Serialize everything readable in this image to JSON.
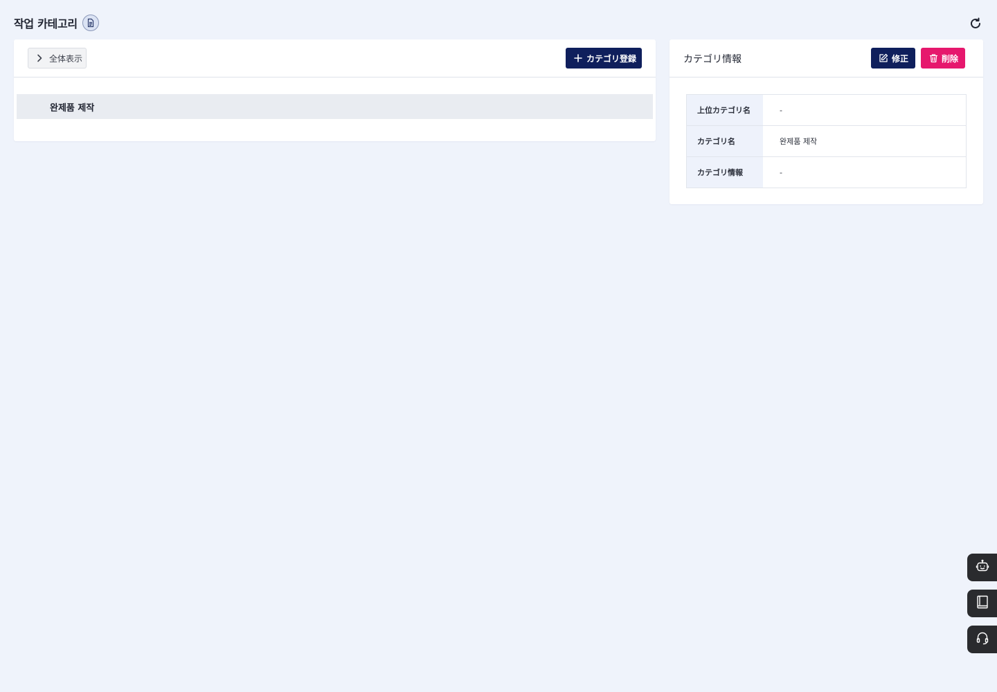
{
  "header": {
    "title": "작업 카테고리",
    "doc_icon": "document-icon",
    "refresh_icon": "refresh-icon"
  },
  "tree_panel": {
    "expand_all_label": "全体表示",
    "add_category_label": "カテゴリ登録",
    "items": [
      {
        "label": "완제품 제작"
      }
    ]
  },
  "detail_panel": {
    "title": "カテゴリ情報",
    "edit_label": "修正",
    "delete_label": "削除",
    "rows": [
      {
        "label": "上位カテゴリ名",
        "value": "-"
      },
      {
        "label": "カテゴリ名",
        "value": "완제품 제작"
      },
      {
        "label": "カテゴリ情報",
        "value": "-"
      }
    ]
  },
  "floating": {
    "bot_icon": "chatbot-icon",
    "manual_icon": "book-icon",
    "support_icon": "headset-icon"
  },
  "colors": {
    "background": "#eff3fb",
    "primary": "#0f1f5c",
    "danger": "#e6186d",
    "float_bg": "#2a2b2e"
  }
}
